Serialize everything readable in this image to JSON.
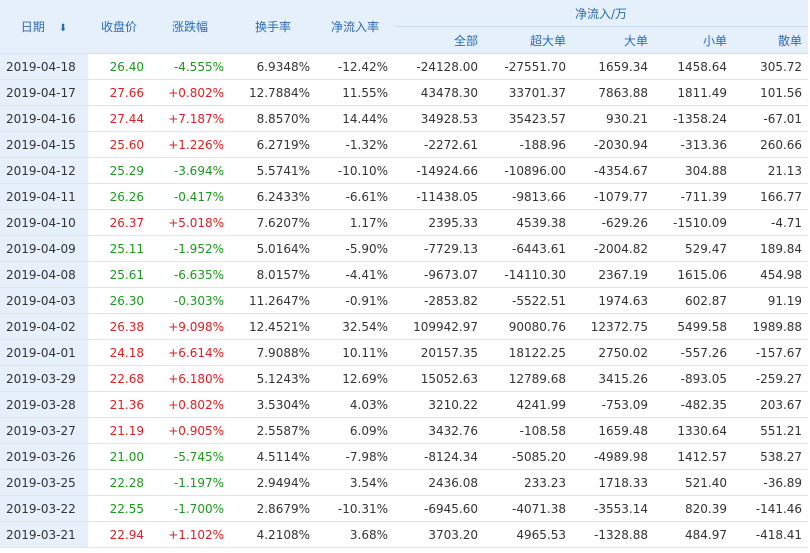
{
  "colors": {
    "up": "#e02020",
    "down": "#1a9a1a",
    "header_text": "#2a6bb8",
    "header_bg": "#e6f0fb"
  },
  "header": {
    "date": "日期",
    "sort_icon": "sort-down-icon",
    "close": "收盘价",
    "change": "涨跌幅",
    "turnover": "换手率",
    "net_rate": "净流入率",
    "net_flow": "净流入/万",
    "total": "全部",
    "super": "超大单",
    "large": "大单",
    "small": "小单",
    "retail": "散单"
  },
  "rows": [
    {
      "date": "2019-04-18",
      "close": "26.40",
      "change": "-4.555%",
      "turnover": "6.9348%",
      "rate": "-12.42%",
      "total": "-24128.00",
      "super": "-27551.70",
      "large": "1659.34",
      "small": "1458.64",
      "retail": "305.72",
      "dir": "down"
    },
    {
      "date": "2019-04-17",
      "close": "27.66",
      "change": "+0.802%",
      "turnover": "12.7884%",
      "rate": "11.55%",
      "total": "43478.30",
      "super": "33701.37",
      "large": "7863.88",
      "small": "1811.49",
      "retail": "101.56",
      "dir": "up"
    },
    {
      "date": "2019-04-16",
      "close": "27.44",
      "change": "+7.187%",
      "turnover": "8.8570%",
      "rate": "14.44%",
      "total": "34928.53",
      "super": "35423.57",
      "large": "930.21",
      "small": "-1358.24",
      "retail": "-67.01",
      "dir": "up"
    },
    {
      "date": "2019-04-15",
      "close": "25.60",
      "change": "+1.226%",
      "turnover": "6.2719%",
      "rate": "-1.32%",
      "total": "-2272.61",
      "super": "-188.96",
      "large": "-2030.94",
      "small": "-313.36",
      "retail": "260.66",
      "dir": "up"
    },
    {
      "date": "2019-04-12",
      "close": "25.29",
      "change": "-3.694%",
      "turnover": "5.5741%",
      "rate": "-10.10%",
      "total": "-14924.66",
      "super": "-10896.00",
      "large": "-4354.67",
      "small": "304.88",
      "retail": "21.13",
      "dir": "down"
    },
    {
      "date": "2019-04-11",
      "close": "26.26",
      "change": "-0.417%",
      "turnover": "6.2433%",
      "rate": "-6.61%",
      "total": "-11438.05",
      "super": "-9813.66",
      "large": "-1079.77",
      "small": "-711.39",
      "retail": "166.77",
      "dir": "down"
    },
    {
      "date": "2019-04-10",
      "close": "26.37",
      "change": "+5.018%",
      "turnover": "7.6207%",
      "rate": "1.17%",
      "total": "2395.33",
      "super": "4539.38",
      "large": "-629.26",
      "small": "-1510.09",
      "retail": "-4.71",
      "dir": "up"
    },
    {
      "date": "2019-04-09",
      "close": "25.11",
      "change": "-1.952%",
      "turnover": "5.0164%",
      "rate": "-5.90%",
      "total": "-7729.13",
      "super": "-6443.61",
      "large": "-2004.82",
      "small": "529.47",
      "retail": "189.84",
      "dir": "down"
    },
    {
      "date": "2019-04-08",
      "close": "25.61",
      "change": "-6.635%",
      "turnover": "8.0157%",
      "rate": "-4.41%",
      "total": "-9673.07",
      "super": "-14110.30",
      "large": "2367.19",
      "small": "1615.06",
      "retail": "454.98",
      "dir": "down"
    },
    {
      "date": "2019-04-03",
      "close": "26.30",
      "change": "-0.303%",
      "turnover": "11.2647%",
      "rate": "-0.91%",
      "total": "-2853.82",
      "super": "-5522.51",
      "large": "1974.63",
      "small": "602.87",
      "retail": "91.19",
      "dir": "down"
    },
    {
      "date": "2019-04-02",
      "close": "26.38",
      "change": "+9.098%",
      "turnover": "12.4521%",
      "rate": "32.54%",
      "total": "109942.97",
      "super": "90080.76",
      "large": "12372.75",
      "small": "5499.58",
      "retail": "1989.88",
      "dir": "up"
    },
    {
      "date": "2019-04-01",
      "close": "24.18",
      "change": "+6.614%",
      "turnover": "7.9088%",
      "rate": "10.11%",
      "total": "20157.35",
      "super": "18122.25",
      "large": "2750.02",
      "small": "-557.26",
      "retail": "-157.67",
      "dir": "up"
    },
    {
      "date": "2019-03-29",
      "close": "22.68",
      "change": "+6.180%",
      "turnover": "5.1243%",
      "rate": "12.69%",
      "total": "15052.63",
      "super": "12789.68",
      "large": "3415.26",
      "small": "-893.05",
      "retail": "-259.27",
      "dir": "up"
    },
    {
      "date": "2019-03-28",
      "close": "21.36",
      "change": "+0.802%",
      "turnover": "3.5304%",
      "rate": "4.03%",
      "total": "3210.22",
      "super": "4241.99",
      "large": "-753.09",
      "small": "-482.35",
      "retail": "203.67",
      "dir": "up"
    },
    {
      "date": "2019-03-27",
      "close": "21.19",
      "change": "+0.905%",
      "turnover": "2.5587%",
      "rate": "6.09%",
      "total": "3432.76",
      "super": "-108.58",
      "large": "1659.48",
      "small": "1330.64",
      "retail": "551.21",
      "dir": "up"
    },
    {
      "date": "2019-03-26",
      "close": "21.00",
      "change": "-5.745%",
      "turnover": "4.5114%",
      "rate": "-7.98%",
      "total": "-8124.34",
      "super": "-5085.20",
      "large": "-4989.98",
      "small": "1412.57",
      "retail": "538.27",
      "dir": "down"
    },
    {
      "date": "2019-03-25",
      "close": "22.28",
      "change": "-1.197%",
      "turnover": "2.9494%",
      "rate": "3.54%",
      "total": "2436.08",
      "super": "233.23",
      "large": "1718.33",
      "small": "521.40",
      "retail": "-36.89",
      "dir": "down"
    },
    {
      "date": "2019-03-22",
      "close": "22.55",
      "change": "-1.700%",
      "turnover": "2.8679%",
      "rate": "-10.31%",
      "total": "-6945.60",
      "super": "-4071.38",
      "large": "-3553.14",
      "small": "820.39",
      "retail": "-141.46",
      "dir": "down"
    },
    {
      "date": "2019-03-21",
      "close": "22.94",
      "change": "+1.102%",
      "turnover": "4.2108%",
      "rate": "3.68%",
      "total": "3703.20",
      "super": "4965.53",
      "large": "-1328.88",
      "small": "484.97",
      "retail": "-418.41",
      "dir": "up"
    }
  ]
}
